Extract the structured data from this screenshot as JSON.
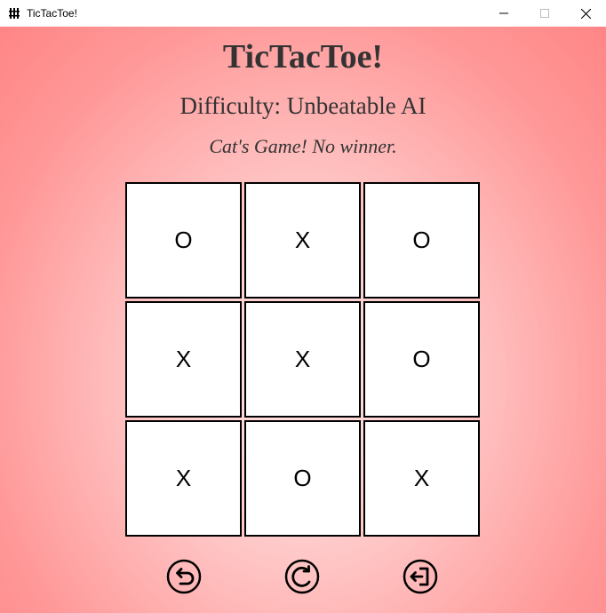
{
  "window": {
    "title": "TicTacToe!"
  },
  "header": {
    "title": "TicTacToe!",
    "difficulty": "Difficulty: Unbeatable AI",
    "status": "Cat's Game! No winner."
  },
  "board": {
    "cells": [
      "O",
      "X",
      "O",
      "X",
      "X",
      "O",
      "X",
      "O",
      "X"
    ]
  },
  "controls": {
    "icons": [
      "undo-icon",
      "restart-icon",
      "exit-icon"
    ]
  },
  "colors": {
    "background_outer": "#ff8585",
    "background_inner": "#ffe3e3",
    "text": "#333333",
    "cell_background": "#ffffff",
    "cell_border": "#000000"
  }
}
